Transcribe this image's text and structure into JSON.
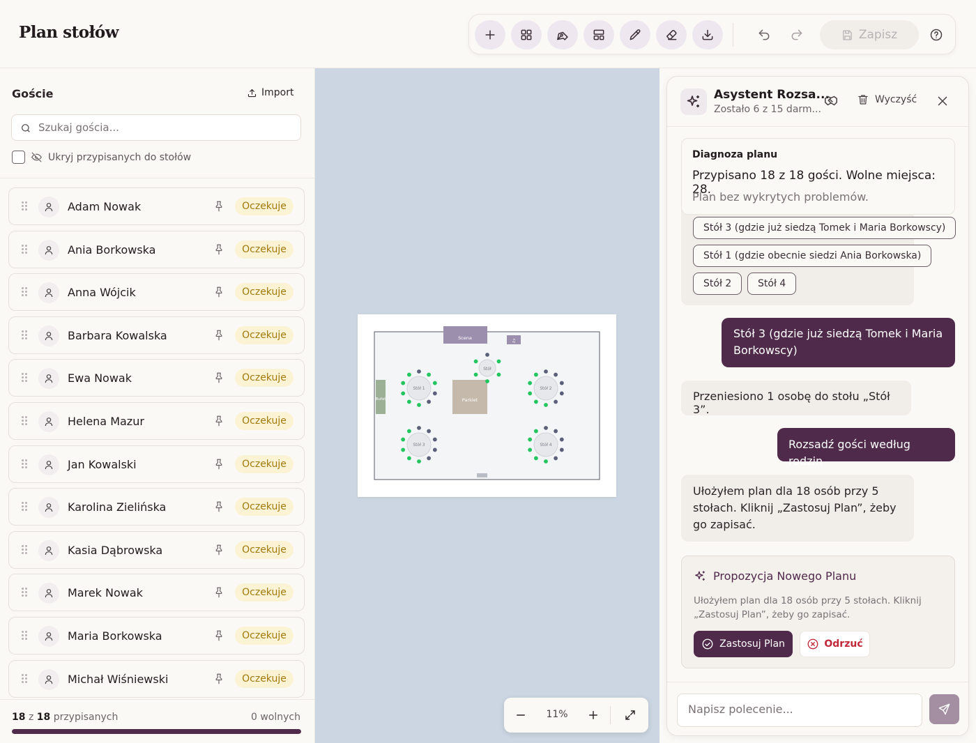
{
  "app": {
    "title": "Plan stołów"
  },
  "toolbar": {
    "tools": [
      {
        "icon": "plus-icon",
        "label": "Dodaj"
      },
      {
        "icon": "grid-icon",
        "label": "Układ"
      },
      {
        "icon": "pen-tool-icon",
        "label": "Rysuj"
      },
      {
        "icon": "layout-icon",
        "label": "Szablon"
      },
      {
        "icon": "pencil-icon",
        "label": "Edytuj"
      },
      {
        "icon": "eraser-icon",
        "label": "Gumka"
      },
      {
        "icon": "download-icon",
        "label": "Pobierz"
      }
    ],
    "save_label": "Zapisz"
  },
  "sidebar": {
    "title": "Goście",
    "import_label": "Import",
    "search_placeholder": "Szukaj gościa...",
    "hide_assigned_label": "Ukryj przypisanych do stołów",
    "guests": [
      {
        "name": "Adam Nowak",
        "status": "Oczekuje"
      },
      {
        "name": "Ania Borkowska",
        "status": "Oczekuje"
      },
      {
        "name": "Anna Wójcik",
        "status": "Oczekuje"
      },
      {
        "name": "Barbara Kowalska",
        "status": "Oczekuje"
      },
      {
        "name": "Ewa Nowak",
        "status": "Oczekuje"
      },
      {
        "name": "Helena Mazur",
        "status": "Oczekuje"
      },
      {
        "name": "Jan Kowalski",
        "status": "Oczekuje"
      },
      {
        "name": "Karolina Zielińska",
        "status": "Oczekuje"
      },
      {
        "name": "Kasia Dąbrowska",
        "status": "Oczekuje"
      },
      {
        "name": "Marek Nowak",
        "status": "Oczekuje"
      },
      {
        "name": "Maria Borkowska",
        "status": "Oczekuje"
      },
      {
        "name": "Michał Wiśniewski",
        "status": "Oczekuje"
      }
    ],
    "footer": {
      "assigned_count": "18",
      "of_word": "z",
      "total_count": "18",
      "assigned_word": "przypisanych",
      "free_text": "0 wolnych",
      "progress_fraction": 1.0
    }
  },
  "floor_plan": {
    "labels": {
      "stage": "Scena",
      "buffet": "Bufet",
      "dance_floor": "Parkiet",
      "top_table": "Stół",
      "table1": "Stół 1",
      "table2": "Stół 2",
      "table3": "Stół 3",
      "table4": "Stół 4"
    },
    "zoom": "11%"
  },
  "assistant": {
    "title": "Asystent Rozsa...",
    "subtitle": "Zostało 6 z 15 darm...",
    "clear_label": "Wyczyść",
    "diagnosis": {
      "title": "Diagnoza planu",
      "main": "Przypisano 18 z 18 gości. Wolne miejsca: 28.",
      "sub": "Plan bez wykrytych problemów."
    },
    "options": [
      "Stół 3 (gdzie już siedzą Tomek i Maria Borkowscy)",
      "Stół 1 (gdzie obecnie siedzi Ania Borkowska)",
      "Stół 2",
      "Stół 4"
    ],
    "user_msg_1": "Stół 3 (gdzie już siedzą Tomek i Maria Borkowscy)",
    "assistant_msg_1": "Przeniesiono 1 osobę do stołu „Stół 3”.",
    "user_msg_2": "Rozsadź gości według rodzin",
    "assistant_msg_2": "Ułożyłem plan dla 18 osób przy 5 stołach. Kliknij „Zastosuj Plan”, żeby go zapisać.",
    "proposal": {
      "title": "Propozycja Nowego Planu",
      "text": "Ułożyłem plan dla 18 osób przy 5 stołach. Kliknij „Zastosuj Plan”, żeby go zapisać.",
      "apply_label": "Zastosuj Plan",
      "reject_label": "Odrzuć"
    },
    "input_placeholder": "Napisz polecenie..."
  },
  "colors": {
    "brand": "#4f2a4a",
    "badge_bg": "#fcf2d4",
    "badge_text": "#a17a0a",
    "canvas_bg": "#cbd6e2",
    "seat_assigned": "#22c55e",
    "seat_empty": "#5b5f7a"
  }
}
